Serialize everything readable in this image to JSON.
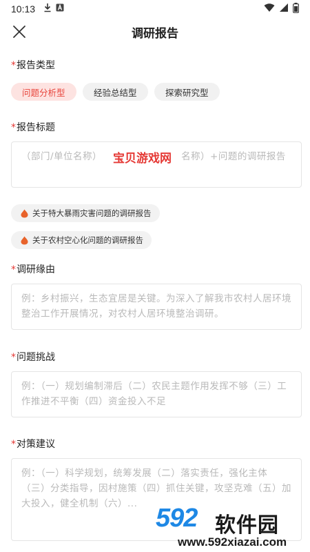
{
  "status_bar": {
    "time": "10:13",
    "icons_left": [
      "download-icon",
      "a-badge-icon"
    ],
    "icons_right": [
      "wifi-icon",
      "signal-icon",
      "battery-icon"
    ]
  },
  "header": {
    "title": "调研报告",
    "close_icon": "close-icon"
  },
  "report_type": {
    "required_mark": "*",
    "label": "报告类型",
    "options": [
      "问题分析型",
      "经验总结型",
      "探索研究型"
    ],
    "selected": "问题分析型"
  },
  "report_title": {
    "required_mark": "*",
    "label": "报告标题",
    "placeholder": "（部门/单位名称）（调研对象名称）+问题的调研报告",
    "placeholder_visible_start": "（部门/单位名称）",
    "placeholder_visible_end": "名称）+问题的调研报告",
    "suggestions": [
      "关于特大暴雨灾害问题的调研报告",
      "关于农村空心化问题的调研报告"
    ]
  },
  "reason": {
    "required_mark": "*",
    "label": "调研缘由",
    "placeholder": "例：乡村振兴，生态宜居是关键。为深入了解我市农村人居环境整治工作开展情况，对农村人居环境整治调研。"
  },
  "challenges": {
    "required_mark": "*",
    "label": "问题挑战",
    "placeholder": "例：（一）规划编制滞后（二）农民主题作用发挥不够（三）工作推进不平衡（四）资金投入不足"
  },
  "suggestions": {
    "required_mark": "*",
    "label": "对策建议",
    "placeholder": "例：（一）科学规划，统筹发展（二）落实责任，强化主体（三）分类指导，因村施策（四）抓住关键，攻坚克难（五）加大投入，健全机制（六）..."
  },
  "watermark": {
    "text": "宝贝游戏网",
    "brand_num": "592",
    "brand_name": "软件园",
    "brand_url": "www.592xiazai.com"
  },
  "colors": {
    "accent": "#e8453c",
    "chip_active_bg": "#fde3e1",
    "placeholder": "#b9b9b9",
    "brand_blue": "#1e88e5"
  }
}
